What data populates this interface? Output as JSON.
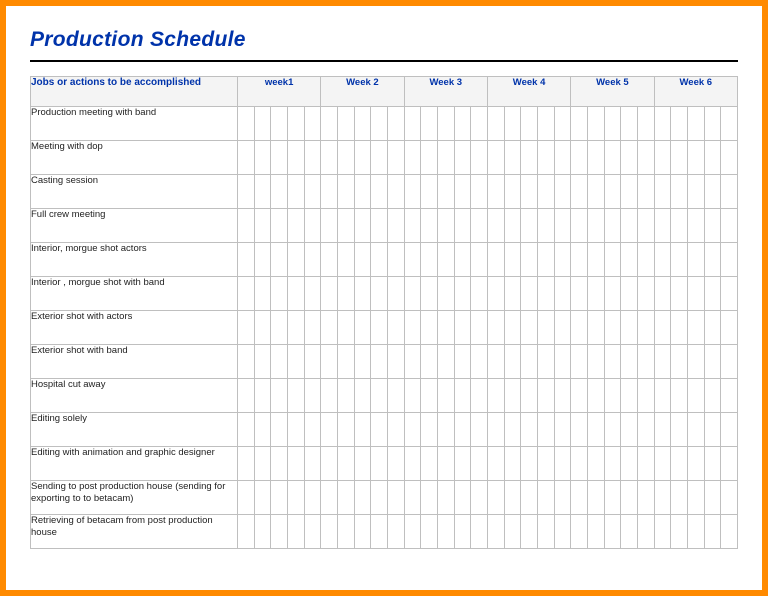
{
  "title": "Production Schedule",
  "headers": {
    "jobs": "Jobs or actions to be accomplished",
    "weeks": [
      "week1",
      "Week 2",
      "Week 3",
      "Week 4",
      "Week 5",
      "Week 6"
    ]
  },
  "days_per_week": 5,
  "jobs": [
    "Production meeting with band",
    "Meeting with  dop",
    "Casting session",
    "Full crew meeting",
    "Interior, morgue shot actors",
    "Interior , morgue shot with band",
    "Exterior shot with actors",
    "Exterior shot with band",
    "Hospital cut away",
    "Editing solely",
    "Editing with animation and graphic designer",
    "Sending to  post production house (sending for exporting to to betacam)",
    "Retrieving of betacam  from post production house"
  ],
  "colors": {
    "frame": "#ff8a00",
    "accent": "#0033aa",
    "rule": "#000000",
    "grid": "#bfbfbf",
    "header_bg": "#f4f4f4"
  }
}
